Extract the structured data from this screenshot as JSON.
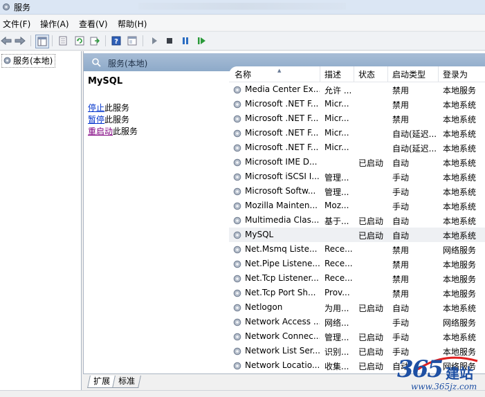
{
  "window": {
    "title": "服务"
  },
  "menu": [
    "文件(F)",
    "操作(A)",
    "查看(V)",
    "帮助(H)"
  ],
  "toolbar": [
    "back-icon",
    "forward-icon",
    "console-tree-icon",
    "properties-icon",
    "refresh-icon",
    "export-icon",
    "help-icon",
    "show-hide-icon",
    "start-service-icon",
    "stop-service-icon",
    "pause-service-icon",
    "resume-service-icon"
  ],
  "tree": {
    "root_label": "服务(本地)"
  },
  "main": {
    "header": "服务(本地)",
    "selected_service": "MySQL",
    "actions": [
      {
        "link": "停止",
        "text": "此服务"
      },
      {
        "link": "暂停",
        "text": "此服务"
      },
      {
        "link": "重启动",
        "text": "此服务"
      }
    ]
  },
  "columns": [
    "名称",
    "描述",
    "状态",
    "启动类型",
    "登录为"
  ],
  "services": [
    {
      "name": "Media Center Ex...",
      "desc": "允许 ...",
      "status": "",
      "startup": "禁用",
      "logon": "本地服务"
    },
    {
      "name": "Microsoft .NET F...",
      "desc": "Micr...",
      "status": "",
      "startup": "禁用",
      "logon": "本地系统"
    },
    {
      "name": "Microsoft .NET F...",
      "desc": "Micr...",
      "status": "",
      "startup": "禁用",
      "logon": "本地系统"
    },
    {
      "name": "Microsoft .NET F...",
      "desc": "Micr...",
      "status": "",
      "startup": "自动(延迟...",
      "logon": "本地系统"
    },
    {
      "name": "Microsoft .NET F...",
      "desc": "Micr...",
      "status": "",
      "startup": "自动(延迟...",
      "logon": "本地系统"
    },
    {
      "name": "Microsoft IME D...",
      "desc": "",
      "status": "已启动",
      "startup": "自动",
      "logon": "本地系统"
    },
    {
      "name": "Microsoft iSCSI I...",
      "desc": "管理...",
      "status": "",
      "startup": "手动",
      "logon": "本地系统"
    },
    {
      "name": "Microsoft Softw...",
      "desc": "管理...",
      "status": "",
      "startup": "手动",
      "logon": "本地系统"
    },
    {
      "name": "Mozilla Mainten...",
      "desc": "Moz...",
      "status": "",
      "startup": "手动",
      "logon": "本地系统"
    },
    {
      "name": "Multimedia Clas...",
      "desc": "基于...",
      "status": "已启动",
      "startup": "自动",
      "logon": "本地系统"
    },
    {
      "name": "MySQL",
      "desc": "",
      "status": "已启动",
      "startup": "自动",
      "logon": "本地系统",
      "selected": true
    },
    {
      "name": "Net.Msmq Liste...",
      "desc": "Rece...",
      "status": "",
      "startup": "禁用",
      "logon": "网络服务"
    },
    {
      "name": "Net.Pipe Listene...",
      "desc": "Rece...",
      "status": "",
      "startup": "禁用",
      "logon": "本地服务"
    },
    {
      "name": "Net.Tcp Listener...",
      "desc": "Rece...",
      "status": "",
      "startup": "禁用",
      "logon": "本地服务"
    },
    {
      "name": "Net.Tcp Port Sh...",
      "desc": "Prov...",
      "status": "",
      "startup": "禁用",
      "logon": "本地服务"
    },
    {
      "name": "Netlogon",
      "desc": "为用...",
      "status": "已启动",
      "startup": "自动",
      "logon": "本地系统"
    },
    {
      "name": "Network Access ...",
      "desc": "网络...",
      "status": "",
      "startup": "手动",
      "logon": "网络服务"
    },
    {
      "name": "Network Connec...",
      "desc": "管理...",
      "status": "已启动",
      "startup": "手动",
      "logon": "本地系统"
    },
    {
      "name": "Network List Ser...",
      "desc": "识别...",
      "status": "已启动",
      "startup": "手动",
      "logon": "本地服务"
    },
    {
      "name": "Network Locatio...",
      "desc": "收集...",
      "status": "已启动",
      "startup": "自动",
      "logon": "网络服务"
    }
  ],
  "tabs": [
    "扩展",
    "标准"
  ],
  "watermark": {
    "number": "365",
    "brand": "建站",
    "url": "www.365jz.com"
  }
}
